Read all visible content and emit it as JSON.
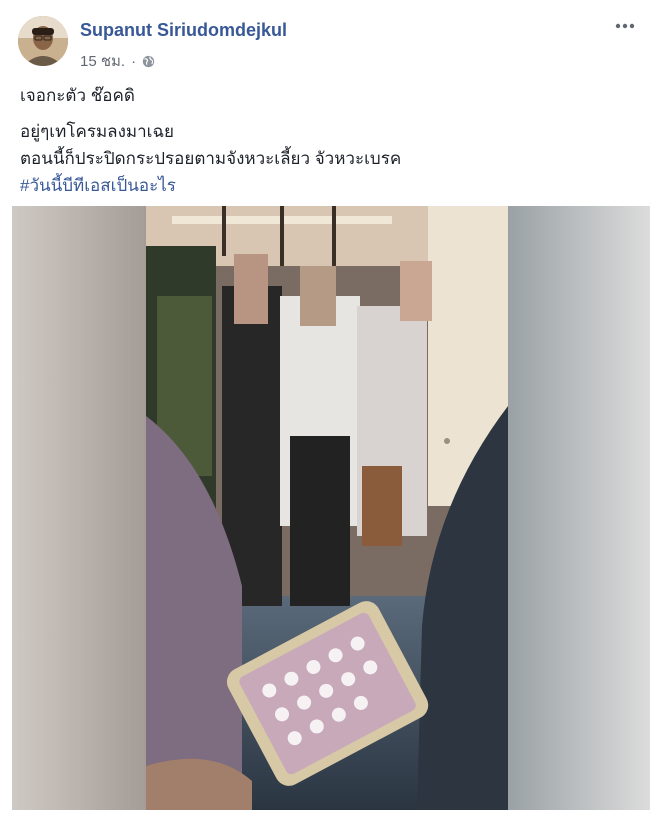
{
  "post": {
    "author": "Supanut Siriudomdejkul",
    "time": "15 ชม.",
    "separator": "·",
    "privacy_icon": "globe-icon",
    "more_icon": "more-options-icon",
    "lines": [
      "เจอกะตัว ช๊อคดิ",
      "อยู่ๆเทโครมลงมาเฉย",
      "ตอนนี้ก็ประปิดกระปรอยตามจังหวะเลี้ยว จัวหวะเบรค"
    ],
    "hashtag": "#วันนี้บีทีเอสเป็นอะไร"
  },
  "colors": {
    "link": "#385898",
    "text": "#1d2129",
    "meta": "#616770"
  }
}
